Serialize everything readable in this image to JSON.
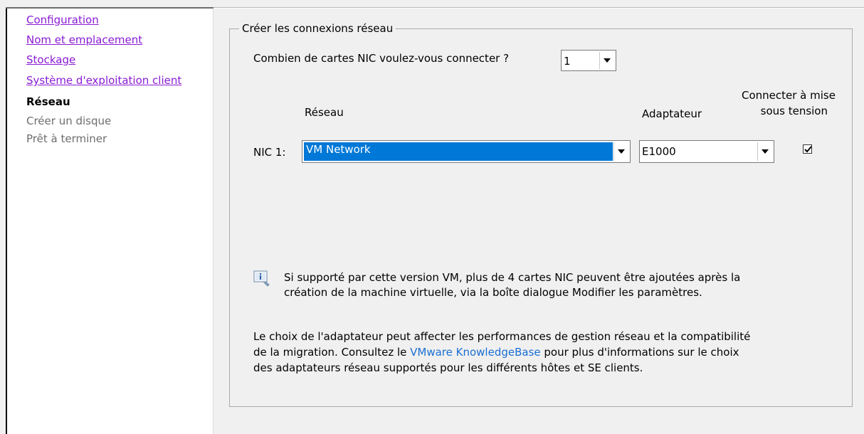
{
  "sidebar": {
    "items": [
      {
        "label": "Configuration",
        "state": "link"
      },
      {
        "label": "Nom et emplacement",
        "state": "link"
      },
      {
        "label": "Stockage",
        "state": "link"
      },
      {
        "label": "Système d'exploitation client",
        "state": "link"
      },
      {
        "label": "Réseau",
        "state": "current"
      },
      {
        "label": "Créer un disque",
        "state": "future"
      },
      {
        "label": "Prêt à terminer",
        "state": "future"
      }
    ]
  },
  "main": {
    "group_title": "Créer les connexions réseau",
    "nic_count_question": "Combien de cartes NIC voulez-vous connecter ?",
    "nic_count_value": "1",
    "columns": {
      "network": "Réseau",
      "adapter": "Adaptateur",
      "connect_line1": "Connecter à mise",
      "connect_line2": "sous tension"
    },
    "nic_row": {
      "label": "NIC 1:",
      "network": "VM Network",
      "adapter": "E1000",
      "connect_checked": true
    },
    "info": {
      "line1": "Si supporté par cette version VM, plus de 4 cartes NIC peuvent être ajoutées après la",
      "line2": "création de la machine virtuelle, via la boîte dialogue Modifier les paramètres."
    },
    "adapter_note": {
      "line1": "Le choix de l'adaptateur peut affecter les performances de gestion réseau et la compatibilité",
      "line2_before": "de la migration. Consultez le ",
      "link": "VMware KnowledgeBase",
      "line2_after": " pour plus d'informations sur le choix",
      "line3": "des adaptateurs réseau supportés pour les différents hôtes et SE clients."
    }
  },
  "colors": {
    "link_visited": "#8a1bd4",
    "selection": "#0078d7",
    "kb_link": "#1a6fd1"
  }
}
